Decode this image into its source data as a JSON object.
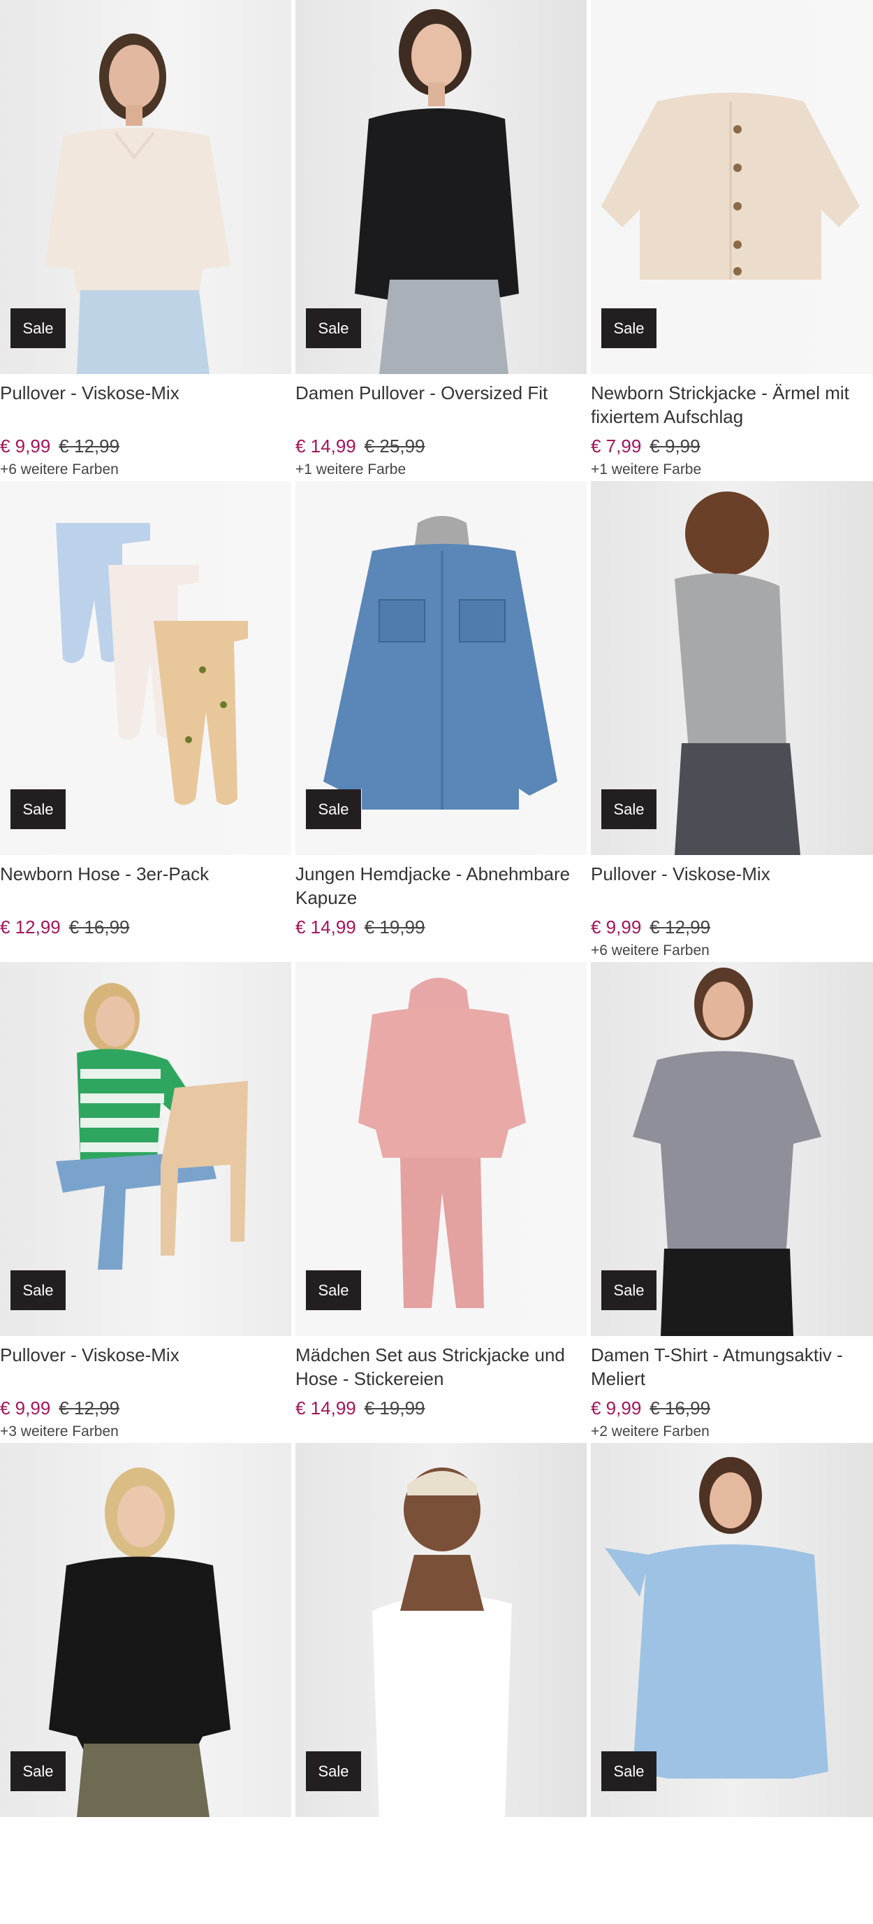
{
  "badge_label": "Sale",
  "colors": {
    "sale_price": "#a4155a",
    "badge_bg": "#231f20"
  },
  "products": [
    {
      "title": "Pullover - Viskose-Mix",
      "price": "€ 9,99",
      "old_price": "€ 12,99",
      "colors_note": "+6 weitere Farben",
      "image": "woman in cream v-neck sweater and light jeans"
    },
    {
      "title": "Damen Pullover - Oversized Fit",
      "price": "€ 14,99",
      "old_price": "€ 25,99",
      "colors_note": "+1 weitere Farbe",
      "image": "woman in black knit pullover and grey cargo pants"
    },
    {
      "title": "Newborn Strickjacke - Ärmel mit fixiertem Aufschlag",
      "price": "€ 7,99",
      "old_price": "€ 9,99",
      "colors_note": "+1 weitere Farbe",
      "image": "beige knitted baby cardigan with buttons"
    },
    {
      "title": "Newborn Hose - 3er-Pack",
      "price": "€ 12,99",
      "old_price": "€ 16,99",
      "colors_note": "",
      "image": "three baby pants light blue, floral, yellow print"
    },
    {
      "title": "Jungen Hemdjacke - Abnehmbare Kapuze",
      "price": "€ 14,99",
      "old_price": "€ 19,99",
      "colors_note": "",
      "image": "denim shirt jacket with grey hood"
    },
    {
      "title": "Pullover - Viskose-Mix",
      "price": "€ 9,99",
      "old_price": "€ 12,99",
      "colors_note": "+6 weitere Farben",
      "image": "woman from behind in grey pullover"
    },
    {
      "title": "Pullover - Viskose-Mix",
      "price": "€ 9,99",
      "old_price": "€ 12,99",
      "colors_note": "+3 weitere Farben",
      "image": "woman in green striped sweater sitting on chair"
    },
    {
      "title": "Mädchen Set aus Strickjacke und Hose - Stickereien",
      "price": "€ 14,99",
      "old_price": "€ 19,99",
      "colors_note": "",
      "image": "pink hoodie and pants set"
    },
    {
      "title": "Damen T-Shirt - Atmungsaktiv - Meliert",
      "price": "€ 9,99",
      "old_price": "€ 16,99",
      "colors_note": "+2 weitere Farben",
      "image": "woman in grey melange t-shirt"
    },
    {
      "title": "",
      "price": "",
      "old_price": "",
      "colors_note": "",
      "image": "woman in black lace-up top"
    },
    {
      "title": "",
      "price": "",
      "old_price": "",
      "colors_note": "",
      "image": "woman in white one-shoulder top"
    },
    {
      "title": "",
      "price": "",
      "old_price": "",
      "colors_note": "",
      "image": "woman in light blue v-neck sweater"
    }
  ]
}
